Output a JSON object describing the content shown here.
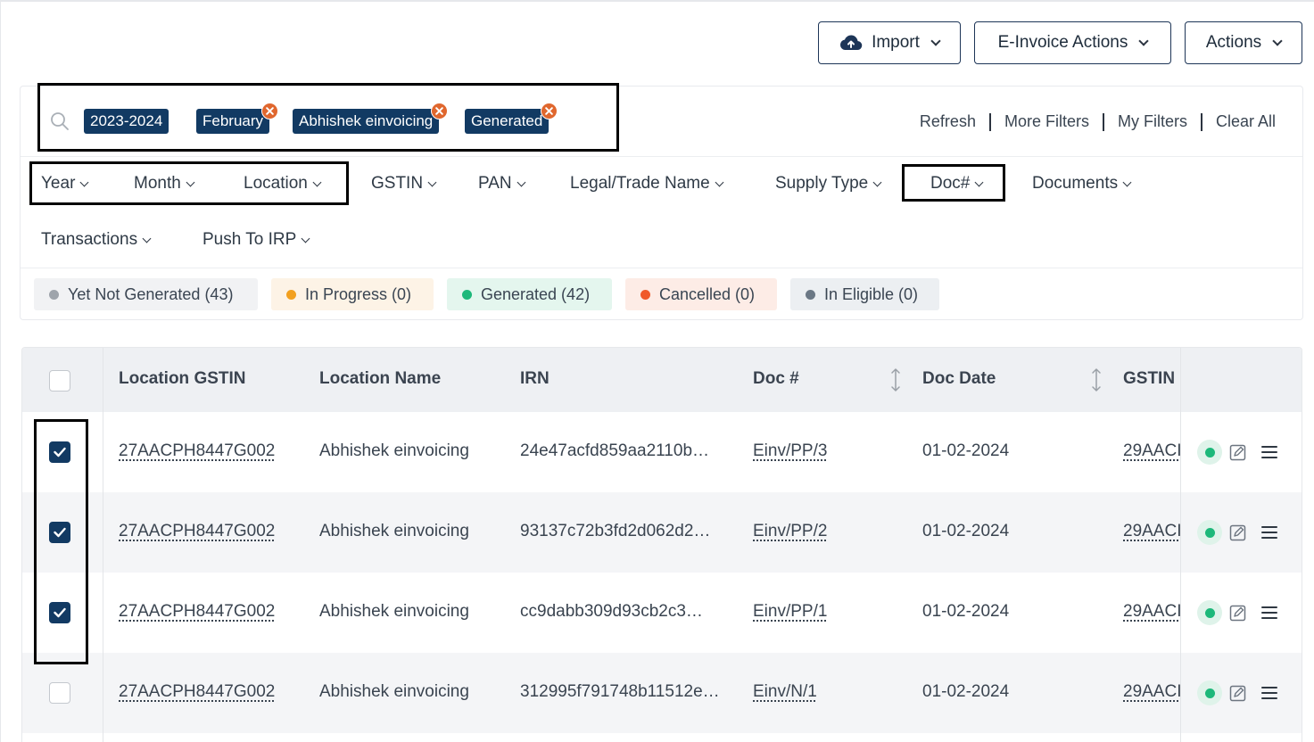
{
  "toolbar": {
    "import_label": "Import",
    "einvoice_label": "E-Invoice Actions",
    "actions_label": "Actions"
  },
  "filters": {
    "chips": [
      "2023-2024",
      "February",
      "Abhishek einvoicing",
      "Generated"
    ],
    "links": [
      "Refresh",
      "More Filters",
      "My Filters",
      "Clear All"
    ],
    "dropdowns": [
      "Year",
      "Month",
      "Location",
      "GSTIN",
      "PAN",
      "Legal/Trade Name",
      "Supply Type",
      "Doc#",
      "Documents",
      "Transactions",
      "Push To IRP"
    ]
  },
  "status_pills": [
    {
      "label": "Yet Not Generated (43)",
      "color": "#9ea4ab",
      "bg": "#f1f2f4"
    },
    {
      "label": "In Progress (0)",
      "color": "#f2a01f",
      "bg": "#fdf3e6"
    },
    {
      "label": "Generated (42)",
      "color": "#1db87a",
      "bg": "#e4f6ee"
    },
    {
      "label": "Cancelled (0)",
      "color": "#f0592a",
      "bg": "#fdecE6"
    },
    {
      "label": "In Eligible (0)",
      "color": "#6b7885",
      "bg": "#eceff2"
    }
  ],
  "table": {
    "headers": [
      "Location GSTIN",
      "Location Name",
      "IRN",
      "Doc #",
      "Doc Date",
      "GSTIN"
    ],
    "rows": [
      {
        "checked": true,
        "location_gstin": "27AACPH8447G002",
        "location_name": "Abhishek einvoicing",
        "irn": "24e47acfd859aa2110b…",
        "doc_no": "Einv/PP/3",
        "doc_date": "01-02-2024",
        "gstin": "29AACI"
      },
      {
        "checked": true,
        "location_gstin": "27AACPH8447G002",
        "location_name": "Abhishek einvoicing",
        "irn": "93137c72b3fd2d062d2…",
        "doc_no": "Einv/PP/2",
        "doc_date": "01-02-2024",
        "gstin": "29AACI"
      },
      {
        "checked": true,
        "location_gstin": "27AACPH8447G002",
        "location_name": "Abhishek einvoicing",
        "irn": "cc9dabb309d93cb2c3…",
        "doc_no": "Einv/PP/1",
        "doc_date": "01-02-2024",
        "gstin": "29AACI"
      },
      {
        "checked": false,
        "location_gstin": "27AACPH8447G002",
        "location_name": "Abhishek einvoicing",
        "irn": "312995f791748b11512e…",
        "doc_no": "Einv/N/1",
        "doc_date": "01-02-2024",
        "gstin": "29AACI"
      }
    ]
  },
  "colors": {
    "accent": "#123a63",
    "chip_close": "#e0672e",
    "generated": "#1db87a"
  },
  "icons": [
    "cloud-upload-icon",
    "search-icon",
    "close-icon",
    "chevron-down-icon",
    "sort-icon",
    "check-icon",
    "status-dot-icon",
    "edit-icon",
    "menu-icon"
  ]
}
